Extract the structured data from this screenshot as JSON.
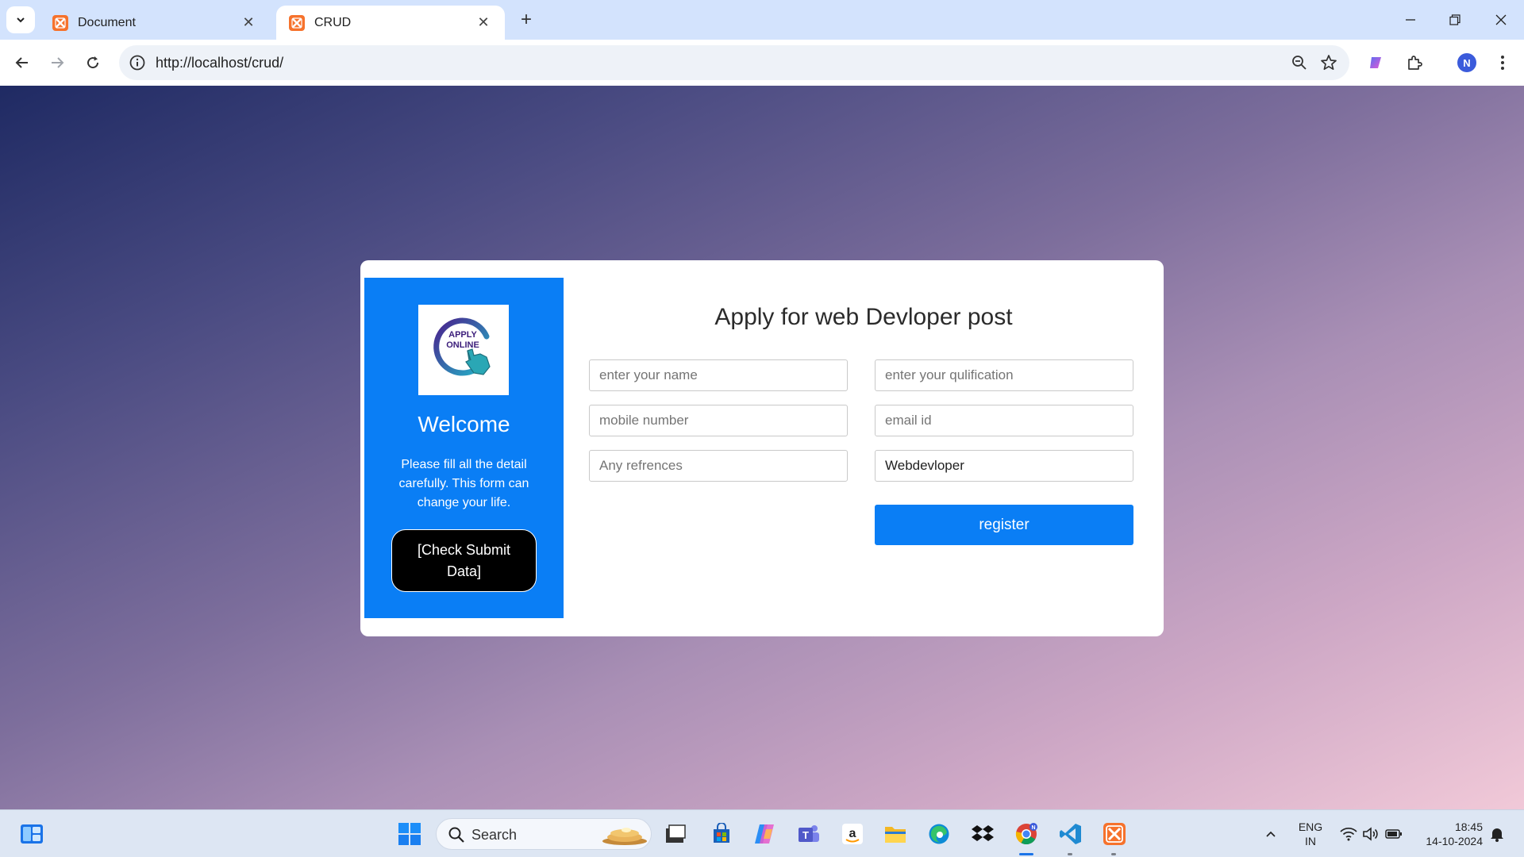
{
  "browser": {
    "tabs": [
      {
        "title": "Document",
        "active": false
      },
      {
        "title": "CRUD",
        "active": true
      }
    ],
    "url": "http://localhost/crud/",
    "profile_initial": "N",
    "accent_color": "#d3e3fd"
  },
  "page": {
    "logo": {
      "line1": "APPLY",
      "line2": "ONLINE"
    },
    "sidebar": {
      "welcome": "Welcome",
      "description": "Please fill all the detail carefully. This form can change your life.",
      "check_button": "[Check Submit Data]",
      "color": "#0a7ef5"
    },
    "form": {
      "title": "Apply for web Devloper post",
      "name_placeholder": "enter your name",
      "qualification_placeholder": "enter your qulification",
      "mobile_placeholder": "mobile number",
      "email_placeholder": "email id",
      "references_placeholder": "Any refrences",
      "post_value": "Webdevloper",
      "register_label": "register"
    }
  },
  "taskbar": {
    "search_label": "Search",
    "language": "ENG",
    "region": "IN",
    "time": "18:45",
    "date": "14-10-2024",
    "apps": [
      "widgets-icon",
      "start-icon",
      "task-view-icon",
      "store-icon",
      "copilot-icon",
      "teams-icon",
      "amazon-icon",
      "file-explorer-icon",
      "edge-icon",
      "dropbox-icon",
      "chrome-icon",
      "vscode-icon",
      "xampp-icon"
    ]
  }
}
